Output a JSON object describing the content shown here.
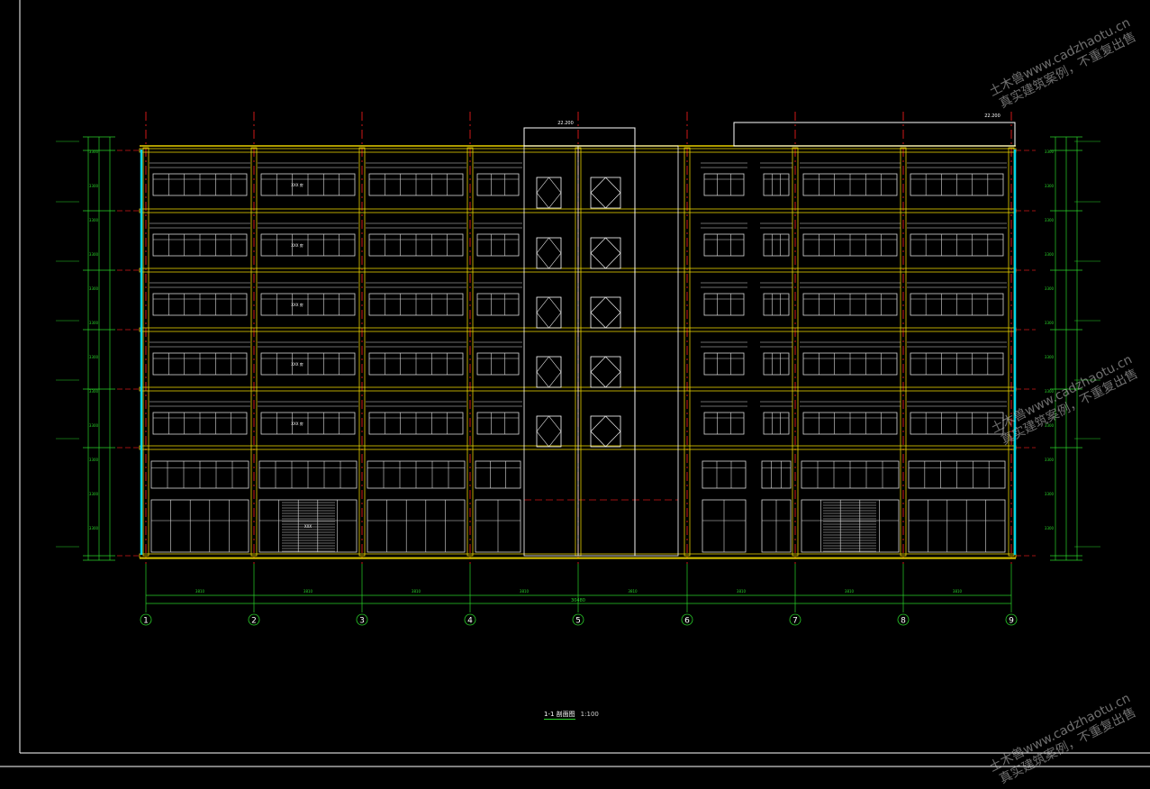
{
  "drawing": {
    "title": "1-1  剖面图",
    "scale": "1:100",
    "axis_labels": [
      "1",
      "2",
      "3",
      "4",
      "5",
      "6",
      "7",
      "8",
      "9"
    ],
    "overall_dim": "30480",
    "roof_elev_mid": "22.200",
    "roof_elev_right": "22.200",
    "room_labels": [
      "XXX 房",
      "XXX 房",
      "XXX 房",
      "XXX 房",
      "XXX 房",
      "XXX 房"
    ]
  },
  "watermarks": [
    {
      "line1": "土木兽www.cadzhaotu.cn",
      "line2": "真实建筑案例，不重复出售"
    },
    {
      "line1": "土木兽www.cadzhaotu.cn",
      "line2": "真实建筑案例，不重复出售"
    },
    {
      "line1": "土木兽www.cadzhaotu.cn",
      "line2": "真实建筑案例，不重复出售"
    }
  ],
  "colors": {
    "background": "#000000",
    "frame": "#ffffff",
    "slab": "#e8d000",
    "axis": "#d01818",
    "dimension": "#29d129",
    "glass": "#00d4e8",
    "window": "#d8d8d8"
  }
}
